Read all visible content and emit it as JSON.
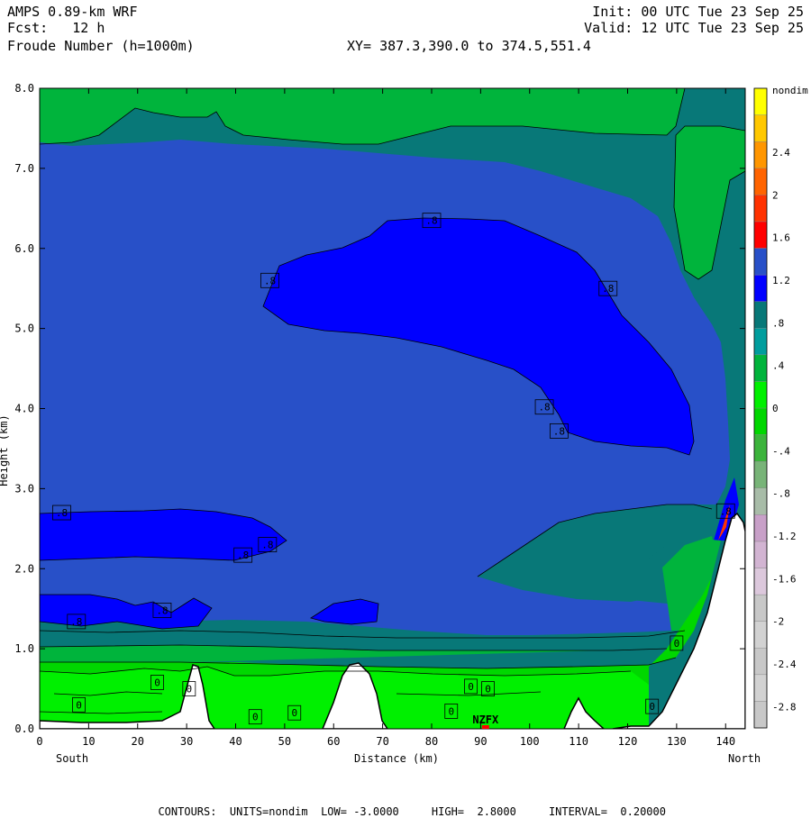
{
  "header": {
    "model": "AMPS 0.89-km WRF",
    "forecast": "Fcst:   12 h",
    "field": "Froude Number (h=1000m)",
    "init": "Init: 00 UTC Tue 23 Sep 25",
    "valid": "Valid: 12 UTC Tue 23 Sep 25",
    "xy": "XY= 387.3,390.0 to 374.5,551.4"
  },
  "footer": {
    "units": "CONTOURS:  UNITS=nondim  LOW= -3.0000",
    "high": "HIGH=  2.8000",
    "interval": "INTERVAL=  0.20000"
  },
  "chart_data": {
    "type": "heatmap",
    "xlabel": "Distance (km)",
    "ylabel": "Height (km)",
    "x_ticks": [
      "0",
      "10",
      "20",
      "30",
      "40",
      "50",
      "60",
      "70",
      "80",
      "90",
      "100",
      "110",
      "120",
      "130",
      "140"
    ],
    "y_ticks": [
      "0.0",
      "1.0",
      "2.0",
      "3.0",
      "4.0",
      "5.0",
      "6.0",
      "7.0",
      "8.0"
    ],
    "xlim": [
      0,
      144
    ],
    "ylim": [
      0,
      8
    ],
    "left_end_label": "South",
    "right_end_label": "North",
    "station_marker": "NZFX",
    "station_x_km": 91,
    "colorbar": {
      "unit_label": "nondim",
      "labels": [
        "2.4",
        "2",
        "1.6",
        "1.2",
        ".8",
        ".4",
        "0",
        "-.4",
        "-.8",
        "-1.2",
        "-1.6",
        "-2",
        "-2.4",
        "-2.8"
      ],
      "colors": [
        "#c8c8c8",
        "#d2d2d2",
        "#c8c8c8",
        "#d2d2d2",
        "#c8c8c8",
        "#dcc8dc",
        "#d2b4d2",
        "#c8a0c8",
        "#a8bca8",
        "#78b478",
        "#3cb43c",
        "#00d700",
        "#00f000",
        "#00b43c",
        "#009d9d",
        "#087878",
        "#0000ff",
        "#2850c8",
        "#ff0000",
        "#ff3200",
        "#ff6400",
        "#ff9600",
        "#ffc800",
        "#ffff00"
      ],
      "note": "bands from -3.0 to 2.8 in 0.2 steps (compressed)"
    },
    "colors": {
      "green_top": "#00b43c",
      "teal": "#087878",
      "blue": "#2850c8",
      "core_blue": "#0000ff",
      "green_low": "#00d700",
      "green_bright": "#00f000",
      "terrain": "#ffffff"
    },
    "contour_labels": [
      {
        "text": ".8",
        "x": 80,
        "y": 6.35
      },
      {
        "text": ".8",
        "x": 47,
        "y": 5.6
      },
      {
        "text": ".8",
        "x": 116,
        "y": 5.5
      },
      {
        "text": ".8",
        "x": 103,
        "y": 4.02
      },
      {
        "text": ".8",
        "x": 106,
        "y": 3.72
      },
      {
        "text": ".8",
        "x": 4.5,
        "y": 2.7
      },
      {
        "text": ".8",
        "x": 46.5,
        "y": 2.3
      },
      {
        "text": ".8",
        "x": 41.5,
        "y": 2.17
      },
      {
        "text": ".8",
        "x": 25,
        "y": 1.48
      },
      {
        "text": ".8",
        "x": 7.5,
        "y": 1.34
      },
      {
        "text": ".8",
        "x": 140,
        "y": 2.72
      },
      {
        "text": "0",
        "x": 24,
        "y": 0.58
      },
      {
        "text": "0",
        "x": 30.5,
        "y": 0.5
      },
      {
        "text": "0",
        "x": 8,
        "y": 0.3
      },
      {
        "text": "0",
        "x": 44,
        "y": 0.15
      },
      {
        "text": "0",
        "x": 52,
        "y": 0.2
      },
      {
        "text": "0",
        "x": 88,
        "y": 0.53
      },
      {
        "text": "0",
        "x": 91.5,
        "y": 0.5
      },
      {
        "text": "0",
        "x": 84,
        "y": 0.22
      },
      {
        "text": "0",
        "x": 125,
        "y": 0.28
      },
      {
        "text": "0",
        "x": 130,
        "y": 1.07
      }
    ]
  }
}
